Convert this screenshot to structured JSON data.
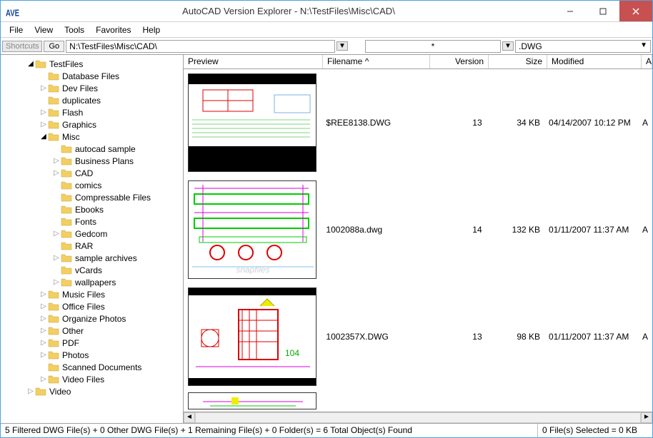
{
  "window": {
    "title": "AutoCAD Version Explorer - N:\\TestFiles\\Misc\\CAD\\",
    "app_abbrev": "AVE"
  },
  "menu": [
    "File",
    "View",
    "Tools",
    "Favorites",
    "Help"
  ],
  "toolbar": {
    "shortcuts_label": "Shortcuts",
    "go_label": "Go",
    "path": "N:\\TestFiles\\Misc\\CAD\\",
    "filter": "*",
    "extension": ".DWG"
  },
  "tree": [
    {
      "d": 2,
      "e": "open",
      "l": "TestFiles"
    },
    {
      "d": 3,
      "e": "",
      "l": "Database Files"
    },
    {
      "d": 3,
      "e": "closed",
      "l": "Dev Files"
    },
    {
      "d": 3,
      "e": "",
      "l": "duplicates"
    },
    {
      "d": 3,
      "e": "closed",
      "l": "Flash"
    },
    {
      "d": 3,
      "e": "closed",
      "l": "Graphics"
    },
    {
      "d": 3,
      "e": "open",
      "l": "Misc"
    },
    {
      "d": 4,
      "e": "",
      "l": "autocad sample"
    },
    {
      "d": 4,
      "e": "closed",
      "l": "Business Plans"
    },
    {
      "d": 4,
      "e": "closed",
      "l": "CAD"
    },
    {
      "d": 4,
      "e": "",
      "l": "comics"
    },
    {
      "d": 4,
      "e": "",
      "l": "Compressable Files"
    },
    {
      "d": 4,
      "e": "",
      "l": "Ebooks"
    },
    {
      "d": 4,
      "e": "",
      "l": "Fonts"
    },
    {
      "d": 4,
      "e": "closed",
      "l": "Gedcom"
    },
    {
      "d": 4,
      "e": "",
      "l": "RAR"
    },
    {
      "d": 4,
      "e": "closed",
      "l": "sample archives"
    },
    {
      "d": 4,
      "e": "",
      "l": "vCards"
    },
    {
      "d": 4,
      "e": "closed",
      "l": "wallpapers"
    },
    {
      "d": 3,
      "e": "closed",
      "l": "Music Files"
    },
    {
      "d": 3,
      "e": "closed",
      "l": "Office Files"
    },
    {
      "d": 3,
      "e": "closed",
      "l": "Organize Photos"
    },
    {
      "d": 3,
      "e": "closed",
      "l": "Other"
    },
    {
      "d": 3,
      "e": "closed",
      "l": "PDF"
    },
    {
      "d": 3,
      "e": "closed",
      "l": "Photos"
    },
    {
      "d": 3,
      "e": "",
      "l": "Scanned Documents"
    },
    {
      "d": 3,
      "e": "closed",
      "l": "Video Files"
    },
    {
      "d": 2,
      "e": "closed",
      "l": "Video"
    }
  ],
  "columns": {
    "preview": "Preview",
    "filename": "Filename ^",
    "version": "Version",
    "size": "Size",
    "modified": "Modified",
    "attribut": "Attribut"
  },
  "rows": [
    {
      "filename": "$REE8138.DWG",
      "version": "13",
      "size": "34 KB",
      "modified": "04/14/2007 10:12 PM",
      "attr": "A",
      "p": 1
    },
    {
      "filename": "1002088a.dwg",
      "version": "14",
      "size": "132 KB",
      "modified": "01/11/2007 11:37 AM",
      "attr": "A",
      "p": 2
    },
    {
      "filename": "1002357X.DWG",
      "version": "13",
      "size": "98 KB",
      "modified": "01/11/2007 11:37 AM",
      "attr": "A",
      "p": 3
    }
  ],
  "status": {
    "left": "5 Filtered DWG File(s) + 0 Other DWG File(s) + 1 Remaining File(s) + 0 Folder(s)  =  6 Total Object(s) Found",
    "right": "0 File(s) Selected = 0 KB"
  }
}
